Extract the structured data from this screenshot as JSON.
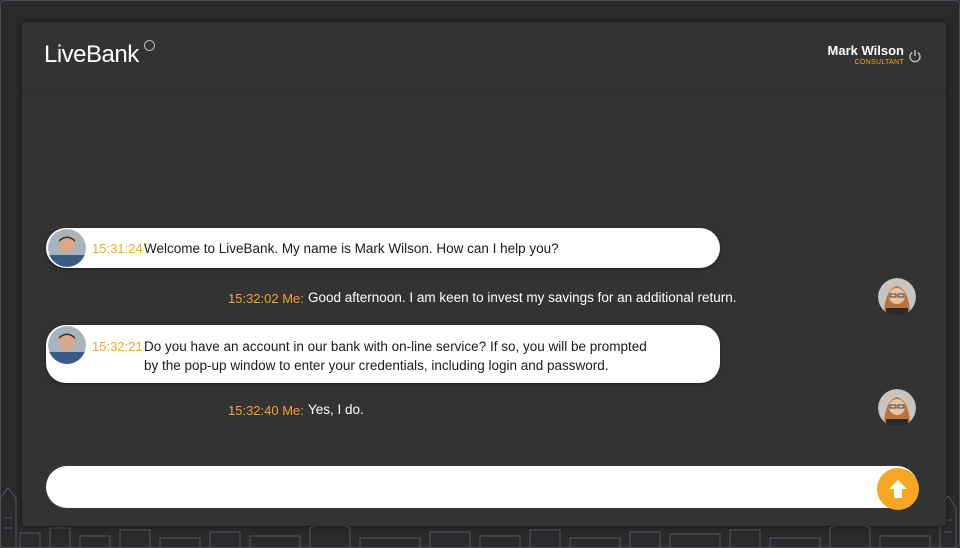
{
  "header": {
    "logo": "LiveBank",
    "user_name": "Mark Wilson",
    "user_role": "CONSULTANT"
  },
  "messages": [
    {
      "sender": "consultant",
      "time": "15:31:24",
      "text": "Welcome to LiveBank. My name is Mark Wilson. How can I help you?"
    },
    {
      "sender": "me",
      "time": "15:32:02 Me:",
      "text": "Good afternoon. I am keen to invest my savings for an additional return."
    },
    {
      "sender": "consultant",
      "time": "15:32:21",
      "text_line1": "Do you have an account in our bank with on-line service? If so, you will be prompted",
      "text_line2": "by the pop-up window to enter your credentials, including login and password."
    },
    {
      "sender": "me",
      "time": "15:32:40 Me:",
      "text": "Yes, I do."
    }
  ],
  "composer": {
    "placeholder": "",
    "value": ""
  },
  "colors": {
    "accent": "#f5a623",
    "panel": "#333333",
    "background": "#2a2a2d"
  },
  "icons": {
    "power": "power-icon",
    "send": "arrow-up-icon"
  }
}
